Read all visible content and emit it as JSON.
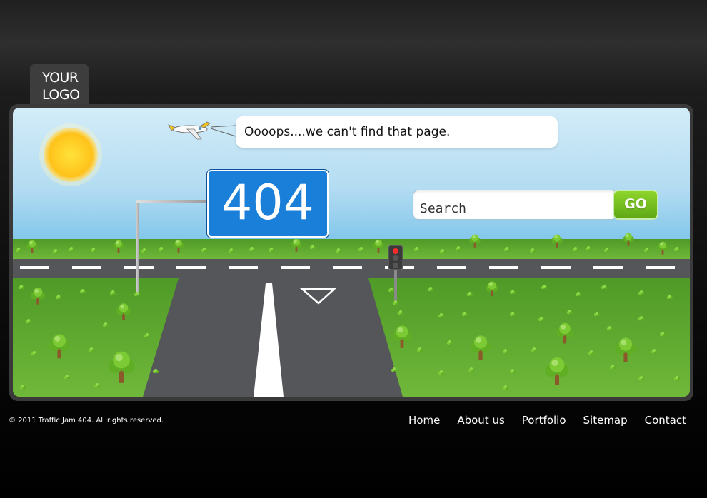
{
  "logo": {
    "line1": "YOUR",
    "line2": "LOGO"
  },
  "message": "Oooops....we can't find that page.",
  "error_code": "404",
  "search": {
    "placeholder": "Search",
    "value": "Search",
    "button_label": "GO"
  },
  "footer": {
    "copyright": "© 2011 Traffic Jam 404. All rights reserved.",
    "nav": [
      {
        "label": "Home"
      },
      {
        "label": "About us"
      },
      {
        "label": "Portfolio"
      },
      {
        "label": "Sitemap"
      },
      {
        "label": "Contact"
      }
    ]
  },
  "colors": {
    "sign_blue": "#1a7fd9",
    "go_green": "#6bb81e",
    "grass": "#5aa62a",
    "road": "#55565a",
    "sky_top": "#cfe9f7",
    "sky_bottom": "#8ecbe9"
  }
}
